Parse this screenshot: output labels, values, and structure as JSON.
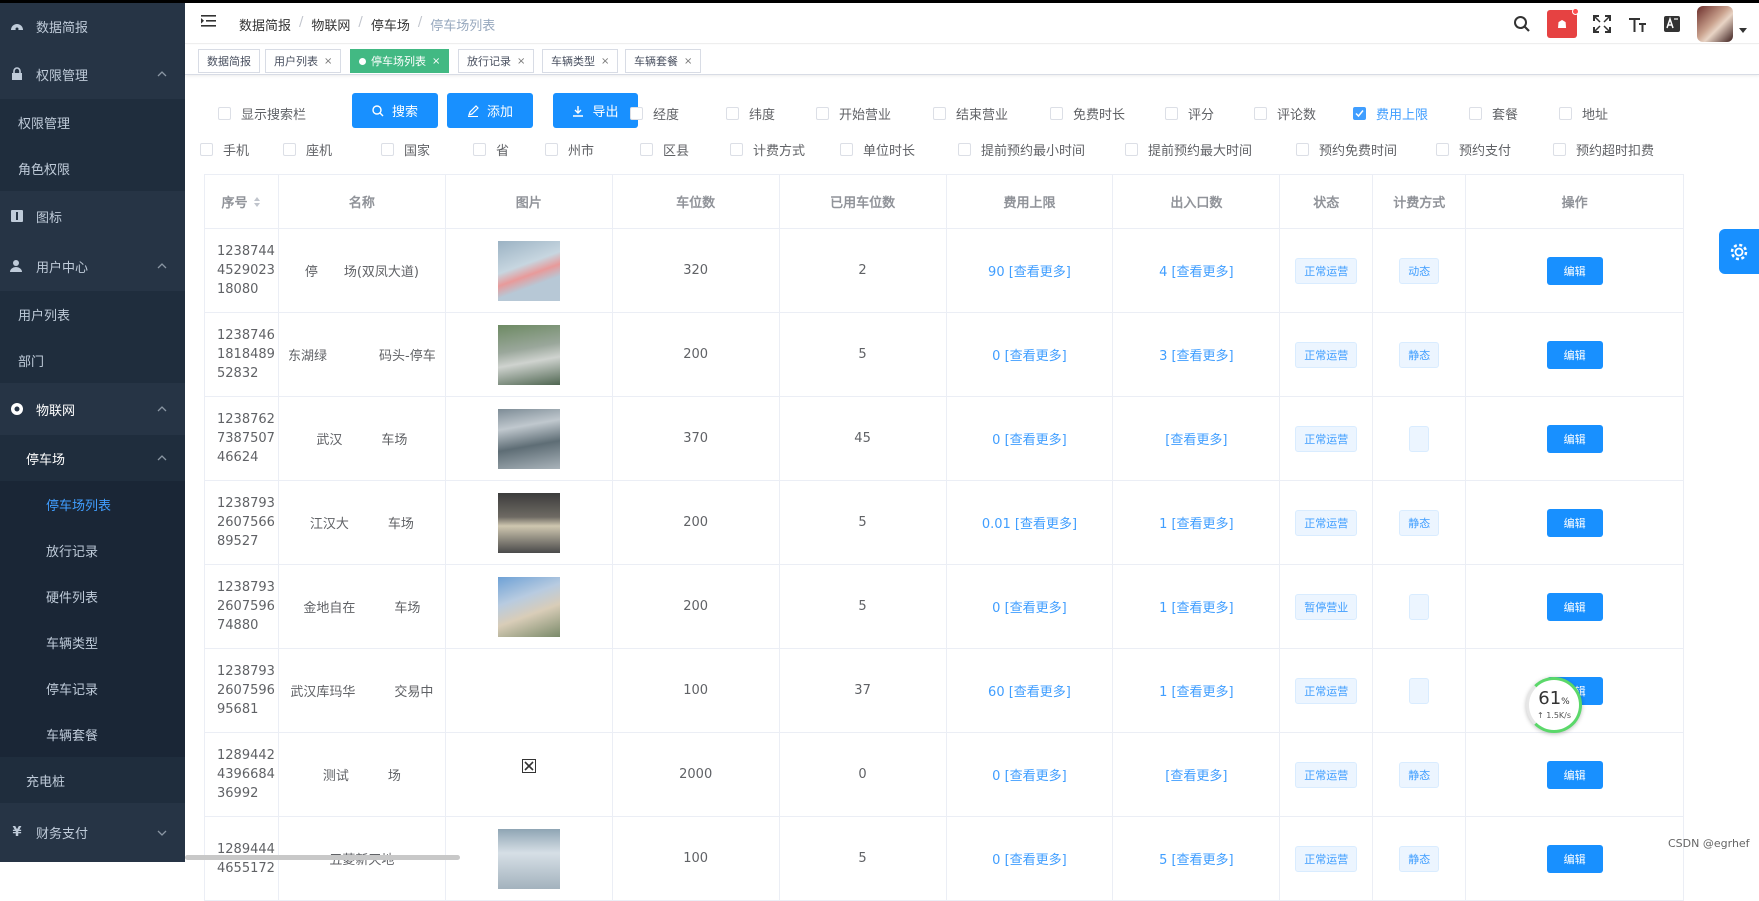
{
  "sidebar": {
    "items": [
      {
        "label": "数据简报",
        "icon": "dashboard-icon",
        "type": "top"
      },
      {
        "label": "权限管理",
        "icon": "lock-icon",
        "type": "top",
        "expanded": true
      },
      {
        "label": "权限管理",
        "type": "sub"
      },
      {
        "label": "角色权限",
        "type": "sub"
      },
      {
        "label": "图标",
        "icon": "book-icon",
        "type": "top"
      },
      {
        "label": "用户中心",
        "icon": "user-icon",
        "type": "top",
        "expanded": true
      },
      {
        "label": "用户列表",
        "type": "sub"
      },
      {
        "label": "部门",
        "type": "sub"
      },
      {
        "label": "物联网",
        "icon": "globe-icon",
        "type": "top",
        "expanded": true
      },
      {
        "label": "停车场",
        "type": "sub",
        "expanded": true
      },
      {
        "label": "停车场列表",
        "type": "sub2",
        "active": true
      },
      {
        "label": "放行记录",
        "type": "sub2"
      },
      {
        "label": "硬件列表",
        "type": "sub2"
      },
      {
        "label": "车辆类型",
        "type": "sub2"
      },
      {
        "label": "停车记录",
        "type": "sub2"
      },
      {
        "label": "车辆套餐",
        "type": "sub2"
      },
      {
        "label": "充电桩",
        "type": "sub"
      },
      {
        "label": "财务支付",
        "icon": "yen-icon",
        "type": "top"
      }
    ]
  },
  "breadcrumb": [
    "数据简报",
    "物联网",
    "停车场",
    "停车场列表"
  ],
  "navbar": {
    "notify_label": "☗"
  },
  "tags": [
    {
      "label": "数据简报",
      "closable": false,
      "active": false
    },
    {
      "label": "用户列表",
      "closable": true,
      "active": false
    },
    {
      "label": "停车场列表",
      "closable": true,
      "active": true
    },
    {
      "label": "放行记录",
      "closable": true,
      "active": false
    },
    {
      "label": "车辆类型",
      "closable": true,
      "active": false
    },
    {
      "label": "车辆套餐",
      "closable": true,
      "active": false
    }
  ],
  "toolbar": {
    "show_search": "显示搜索栏",
    "search": "搜索",
    "add": "添加",
    "export": "导出"
  },
  "column_toggles_row1": [
    {
      "label": "经度",
      "checked": false
    },
    {
      "label": "纬度",
      "checked": false
    },
    {
      "label": "开始营业",
      "checked": false
    },
    {
      "label": "结束营业",
      "checked": false
    },
    {
      "label": "免费时长",
      "checked": false
    },
    {
      "label": "评分",
      "checked": false
    },
    {
      "label": "评论数",
      "checked": false
    },
    {
      "label": "费用上限",
      "checked": true
    },
    {
      "label": "套餐",
      "checked": false
    },
    {
      "label": "地址",
      "checked": false
    }
  ],
  "column_toggles_row2": [
    {
      "label": "手机",
      "checked": false
    },
    {
      "label": "座机",
      "checked": false
    },
    {
      "label": "国家",
      "checked": false
    },
    {
      "label": "省",
      "checked": false
    },
    {
      "label": "州市",
      "checked": false
    },
    {
      "label": "区县",
      "checked": false
    },
    {
      "label": "计费方式",
      "checked": false
    },
    {
      "label": "单位时长",
      "checked": false
    },
    {
      "label": "提前预约最小时间",
      "checked": false
    },
    {
      "label": "提前预约最大时间",
      "checked": false
    },
    {
      "label": "预约免费时间",
      "checked": false
    },
    {
      "label": "预约支付",
      "checked": false
    },
    {
      "label": "预约超时扣费",
      "checked": false
    }
  ],
  "table": {
    "headers": [
      "序号",
      "名称",
      "图片",
      "车位数",
      "已用车位数",
      "费用上限",
      "出入口数",
      "状态",
      "计费方式",
      "操作"
    ],
    "edit_label": "编辑",
    "rows": [
      {
        "id": "1238744452902318080",
        "name": "停　　场(双凤大道)",
        "has_img": true,
        "spots": "320",
        "used": "2",
        "fee": "90 [查看更多]",
        "gates": "4 [查看更多]",
        "status": "正常运营",
        "billing": "动态"
      },
      {
        "id": "1238746181848952832",
        "name": "东湖绿　　　　码头-停车",
        "has_img": true,
        "spots": "200",
        "used": "5",
        "fee": "0 [查看更多]",
        "gates": "3 [查看更多]",
        "status": "正常运营",
        "billing": "静态"
      },
      {
        "id": "1238762738750746624",
        "name": "武汉　　　车场",
        "has_img": true,
        "spots": "370",
        "used": "45",
        "fee": "0 [查看更多]",
        "gates": "[查看更多]",
        "status": "正常运营",
        "billing": ""
      },
      {
        "id": "1238793260756689527",
        "name": "江汉大　　　车场",
        "has_img": true,
        "spots": "200",
        "used": "5",
        "fee": "0.01 [查看更多]",
        "gates": "1 [查看更多]",
        "status": "正常运营",
        "billing": "静态"
      },
      {
        "id": "1238793260759674880",
        "name": "金地自在　　　车场",
        "has_img": true,
        "spots": "200",
        "used": "5",
        "fee": "0 [查看更多]",
        "gates": "1 [查看更多]",
        "status": "暂停营业",
        "billing": ""
      },
      {
        "id": "1238793260759695681",
        "name": "武汉库玛华　　　交易中",
        "has_img": false,
        "spots": "100",
        "used": "37",
        "fee": "60 [查看更多]",
        "gates": "1 [查看更多]",
        "status": "正常运营",
        "billing": ""
      },
      {
        "id": "1289442439668436992",
        "name": "测试　　　场",
        "has_img": false,
        "broken_img": true,
        "spots": "2000",
        "used": "0",
        "fee": "0 [查看更多]",
        "gates": "[查看更多]",
        "status": "正常运营",
        "billing": "静态"
      },
      {
        "id": "12894444655172",
        "name": "五菱新天地",
        "has_img": true,
        "spots": "100",
        "used": "5",
        "fee": "0 [查看更多]",
        "gates": "5 [查看更多]",
        "status": "正常运营",
        "billing": "静态"
      }
    ]
  },
  "speed_widget": {
    "percent": "61",
    "unit": "%",
    "rate": "↑ 1.5K/s"
  },
  "watermark": "CSDN @egrhef"
}
